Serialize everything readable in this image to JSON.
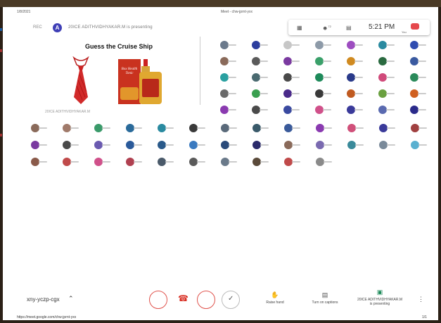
{
  "print_header": {
    "date": "1/8/2021",
    "title": "Meet - chw-jprnt-yxx"
  },
  "meeting": {
    "rec_label": "REC",
    "presenter_initial": "A",
    "presenting_banner": "20ICE ADITHVIDHYAKAR.M is presenting",
    "time": "5:21 PM",
    "you_label": "You",
    "participant_count": "72"
  },
  "slide": {
    "title": "Guess the Cruise Ship",
    "owner_label": "20ICE ADITHVIDHYAKAR.M",
    "product_label": "Box Health Tonic"
  },
  "participants": {
    "colors": [
      "#6b7a8c",
      "#2c3e9e",
      "#c7c7c7",
      "#8d9aa8",
      "#9d4dc0",
      "#2a8aa0",
      "#2f4cb0",
      "#8a6a5a",
      "#5a5a5a",
      "#7a3aa0",
      "#3aa06a",
      "#d08a20",
      "#2a6a40",
      "#3a5aa0",
      "#2aa0a0",
      "#4a6a70",
      "#4a4a4a",
      "#1e8a5a",
      "#2a3a8a",
      "#d04a7a",
      "#2a8a5a",
      "#6a6a6a",
      "#3aa050",
      "#4a2a8a",
      "#3a3a3a",
      "#c05a20",
      "#6aa040",
      "#d06020",
      "#8a3ab0",
      "#4a4a4a",
      "#3a4aa0",
      "#d0508a",
      "#3a3a9a",
      "#5a6ab0",
      "#2a2a8a",
      "#8a6a5a",
      "#a07a6a",
      "#3a9a6a",
      "#2a6a9a",
      "#2a8aa0",
      "#3a3a3a",
      "#5a6a7a",
      "#3a5a6a",
      "#3a5a9a",
      "#8a3ab0",
      "#d0507a",
      "#3a3a9a",
      "#a04040",
      "#7a3aa0",
      "#4a4a4a",
      "#6a5ab0",
      "#2a5a9a",
      "#2a5a8a",
      "#3a7ac0",
      "#2a4a7a",
      "#2a2a6a",
      "#8a6a5a",
      "#7a6ab0",
      "#3a8a9a",
      "#7a8a9a",
      "#5ab0d0",
      "#8a5a4a",
      "#c04a4a",
      "#d0508a",
      "#b04050",
      "#4a5a6a",
      "#5a5a5a",
      "#6a7a8a",
      "#5a4a3a",
      "#c04a4a",
      "#8a8a8a"
    ]
  },
  "controls": {
    "meeting_code": "xny-yczp-cgx",
    "raise_hand_label": "Raise hand",
    "captions_label": "Turn on captions",
    "presenting_name": "20ICE ADITHVIDHYAKAR.M",
    "presenting_state": "is presenting"
  },
  "print_footer": {
    "url": "https://meet.google.com/chw-jprnt-yxx",
    "page": "1/1"
  }
}
